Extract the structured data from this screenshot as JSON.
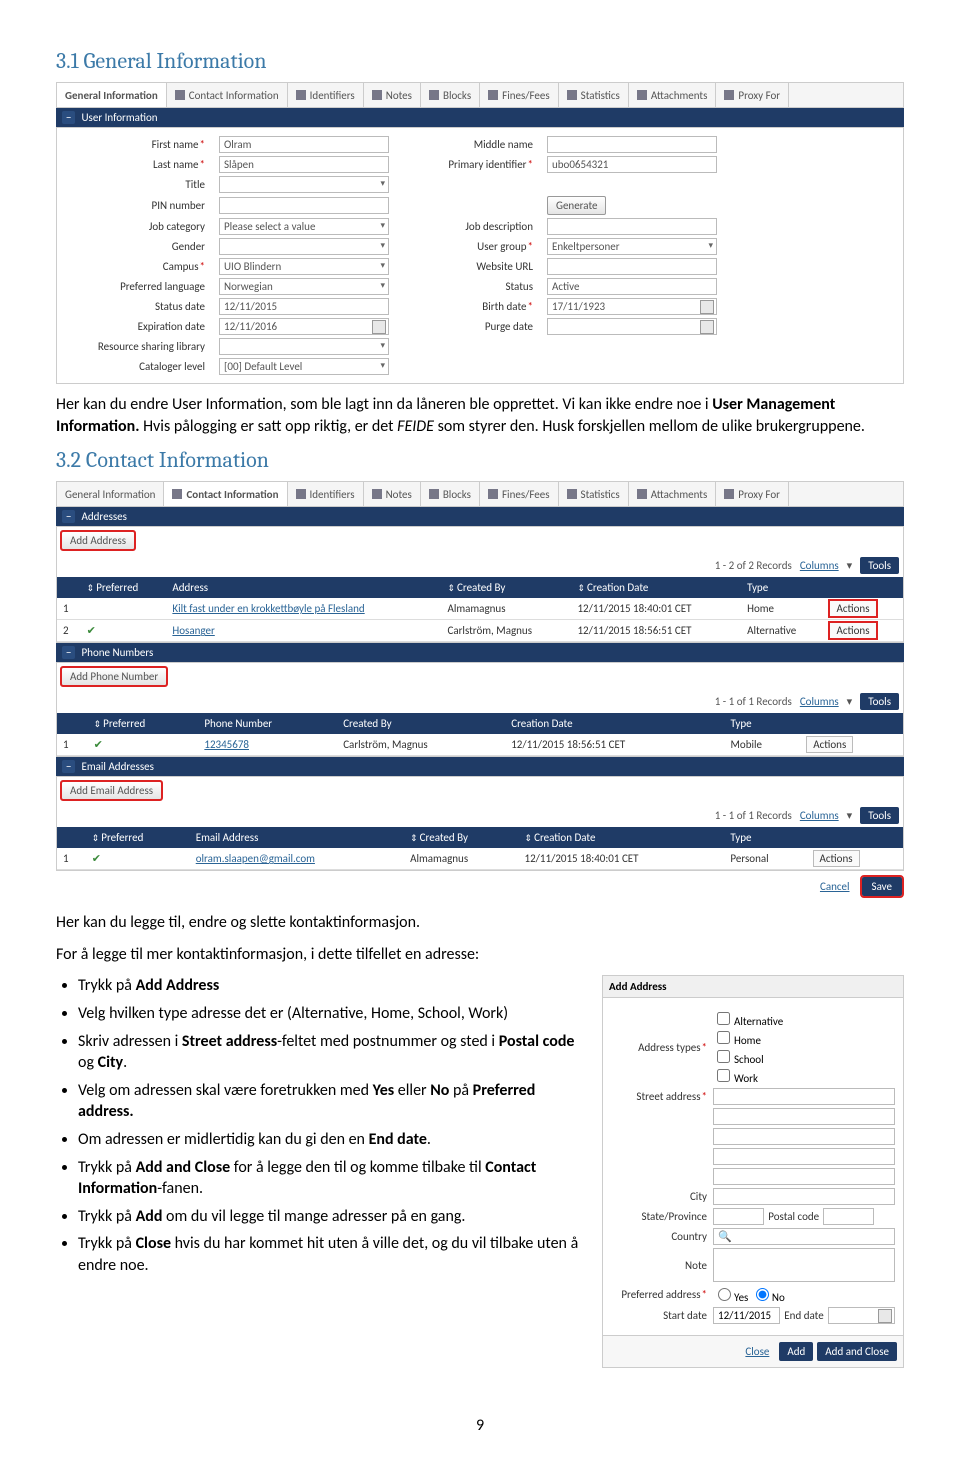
{
  "h1": {
    "title": "3.1 General Information"
  },
  "h2": {
    "title": "3.2 Contact Information"
  },
  "p1a": "Her kan du endre User Information, som ble lagt inn da låneren ble opprettet. Vi kan ikke endre noe i ",
  "p1b": "User Management Information.",
  "p1c": " Hvis pålogging er satt opp riktig, er det ",
  "p1d": "FEIDE",
  "p1e": " som styrer den. Husk forskjellen mellom de ulike brukergruppene.",
  "p2": "Her kan du legge til, endre og slette kontaktinformasjon.",
  "p3": "For å legge til mer kontaktinformasjon, i dette tilfellet en adresse:",
  "tabs": [
    "General Information",
    "Contact Information",
    "Identifiers",
    "Notes",
    "Blocks",
    "Fines/Fees",
    "Statistics",
    "Attachments",
    "Proxy For"
  ],
  "userinfo": {
    "bar": "User Information",
    "fields": {
      "first_name_l": "First name",
      "first_name": "Olram",
      "middle_name_l": "Middle name",
      "middle_name": "",
      "last_name_l": "Last name",
      "last_name": "Slåpen",
      "primary_id_l": "Primary identifier",
      "primary_id": "ubo0654321",
      "title_l": "Title",
      "title": "",
      "pin_l": "PIN number",
      "pin": "",
      "generate": "Generate",
      "jobcat_l": "Job category",
      "jobcat": "Please select a value",
      "jobdesc_l": "Job description",
      "jobdesc": "",
      "gender_l": "Gender",
      "gender": "",
      "usergroup_l": "User group",
      "usergroup": "Enkeltpersoner",
      "campus_l": "Campus",
      "campus": "UIO Blindern",
      "website_l": "Website URL",
      "website": "",
      "preflang_l": "Preferred language",
      "preflang": "Norwegian",
      "status_l": "Status",
      "status": "Active",
      "statusdate_l": "Status date",
      "statusdate": "12/11/2015",
      "birthdate_l": "Birth date",
      "birthdate": "17/11/1923",
      "expdate_l": "Expiration date",
      "expdate": "12/11/2016",
      "purgedate_l": "Purge date",
      "purgedate": "",
      "rsl_l": "Resource sharing library",
      "rsl": "",
      "catlevel_l": "Cataloger level",
      "catlevel": "[00] Default Level"
    }
  },
  "contact": {
    "addresses": {
      "bar": "Addresses",
      "add": "Add Address",
      "rec": "1 - 2 of 2 Records",
      "cols": "Columns",
      "tools": "Tools",
      "cols_h": [
        "",
        "Preferred",
        "Address",
        "Created By",
        "Creation Date",
        "Type",
        ""
      ],
      "rows": [
        {
          "n": "1",
          "pref": "",
          "addr": "Kilt fast under en krokkettbøyle på Flesland",
          "by": "Almamagnus",
          "date": "12/11/2015 18:40:01 CET",
          "type": "Home",
          "act": "Actions"
        },
        {
          "n": "2",
          "pref": "✔",
          "addr": "Hosanger",
          "by": "Carlström, Magnus",
          "date": "12/11/2015 18:56:51 CET",
          "type": "Alternative",
          "act": "Actions"
        }
      ]
    },
    "phones": {
      "bar": "Phone Numbers",
      "add": "Add Phone Number",
      "rec": "1 - 1 of 1 Records",
      "cols": "Columns",
      "tools": "Tools",
      "cols_h": [
        "",
        "Preferred",
        "Phone Number",
        "Created By",
        "Creation Date",
        "Type",
        ""
      ],
      "rows": [
        {
          "n": "1",
          "pref": "✔",
          "val": "12345678",
          "by": "Carlström, Magnus",
          "date": "12/11/2015 18:56:51 CET",
          "type": "Mobile",
          "act": "Actions"
        }
      ]
    },
    "emails": {
      "bar": "Email Addresses",
      "add": "Add Email Address",
      "rec": "1 - 1 of 1 Records",
      "cols": "Columns",
      "tools": "Tools",
      "cols_h": [
        "",
        "Preferred",
        "Email Address",
        "Created By",
        "Creation Date",
        "Type",
        ""
      ],
      "rows": [
        {
          "n": "1",
          "pref": "✔",
          "val": "olram.slaapen@gmail.com",
          "by": "Almamagnus",
          "date": "12/11/2015 18:40:01 CET",
          "type": "Personal",
          "act": "Actions"
        }
      ]
    },
    "cancel": "Cancel",
    "save": "Save"
  },
  "bullets": {
    "b1a": "Trykk på ",
    "b1b": "Add Address",
    "b2a": "Velg hvilken type adresse det er (Alternative, Home, School, Work)",
    "b3a": "Skriv adressen i ",
    "b3b": "Street address",
    "b3c": "-feltet med postnummer og sted i ",
    "b3d": "Postal code",
    "b3e": " og ",
    "b3f": "City",
    "b3g": ".",
    "b4a": "Velg om adressen skal være foretrukken med ",
    "b4b": "Yes",
    "b4c": " eller ",
    "b4d": "No",
    "b4e": " på ",
    "b4f": "Preferred address.",
    "b5a": "Om adressen er midlertidig kan du gi den en ",
    "b5b": "End date",
    "b5c": ".",
    "b6a": "Trykk på ",
    "b6b": "Add and Close",
    "b6c": " for å legge den til og komme tilbake til ",
    "b6d": "Contact Information",
    "b6e": "-fanen.",
    "b7a": "Trykk på ",
    "b7b": "Add",
    "b7c": " om du vil legge til mange adresser på en gang.",
    "b8a": "Trykk på ",
    "b8b": "Close",
    "b8c": " hvis du har kommet hit uten å ville det, og du vil tilbake uten å endre noe."
  },
  "addaddr": {
    "title": "Add Address",
    "types_l": "Address types",
    "types": [
      "Alternative",
      "Home",
      "School",
      "Work"
    ],
    "street_l": "Street address",
    "city_l": "City",
    "state_l": "State/Province",
    "postal_l": "Postal code",
    "country_l": "Country",
    "note_l": "Note",
    "pref_l": "Preferred address",
    "yes": "Yes",
    "no": "No",
    "start_l": "Start date",
    "start": "12/11/2015",
    "end_l": "End date",
    "close": "Close",
    "add": "Add",
    "addclose": "Add and Close"
  },
  "pagenum": "9"
}
